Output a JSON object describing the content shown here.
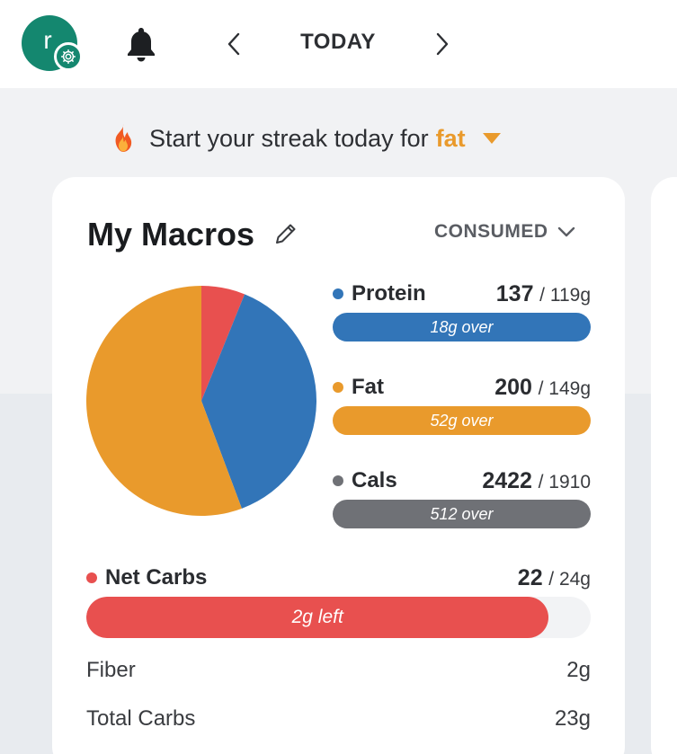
{
  "header": {
    "avatar_initial": "r",
    "date_label": "TODAY",
    "icons": [
      "settings-gear-icon",
      "bell-icon",
      "chevron-left-icon",
      "chevron-right-icon"
    ]
  },
  "streak": {
    "prefix": "Start your streak today for",
    "macro": "fat",
    "icon": "flame-icon"
  },
  "card": {
    "title": "My Macros",
    "view_selector": "CONSUMED"
  },
  "pie_chart": {
    "slices": [
      {
        "name": "Net Carbs",
        "value": 22,
        "color": "#e8504f"
      },
      {
        "name": "Protein",
        "value": 137,
        "color": "#3275b8"
      },
      {
        "name": "Fat",
        "value": 200,
        "color": "#e99a2c"
      }
    ]
  },
  "macros": [
    {
      "name": "Protein",
      "consumed": "137",
      "goal": "/ 119g",
      "status": "18g over",
      "color": "#3275b8"
    },
    {
      "name": "Fat",
      "consumed": "200",
      "goal": "/ 149g",
      "status": "52g over",
      "color": "#e99a2c"
    },
    {
      "name": "Cals",
      "consumed": "2422",
      "goal": "/ 1910",
      "status": "512 over",
      "color": "#6f7176"
    }
  ],
  "net_carbs": {
    "name": "Net Carbs",
    "consumed": "22",
    "goal": "/ 24g",
    "status": "2g left",
    "progress": 0.917,
    "color": "#e8504f"
  },
  "details": [
    {
      "label": "Fiber",
      "value": "2g"
    },
    {
      "label": "Total Carbs",
      "value": "23g"
    }
  ]
}
